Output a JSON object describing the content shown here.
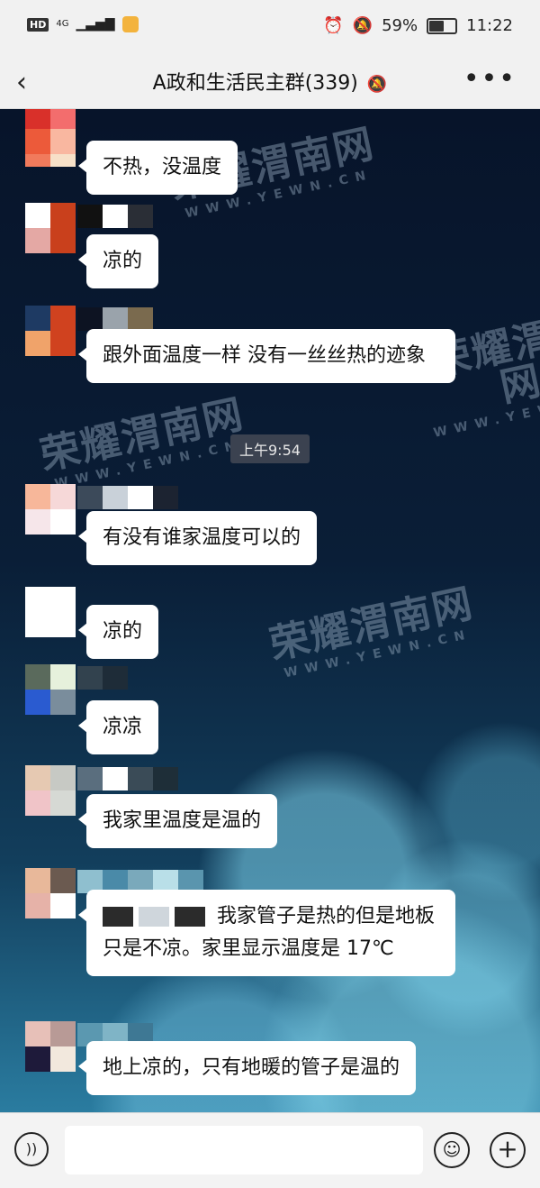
{
  "status_bar": {
    "hd": "HD",
    "network": "4G",
    "battery": "59%",
    "time": "11:22",
    "icons": [
      "alarm-icon",
      "mute-bell-icon",
      "battery-icon"
    ]
  },
  "header": {
    "back_icon": "‹",
    "title": "A政和生活民主群(339)",
    "mute_icon": "bell-off-icon",
    "more_icon": "•••"
  },
  "chat": {
    "timestamp": "上午9:54",
    "messages": [
      {
        "text": "不热，没温度"
      },
      {
        "text": "凉的"
      },
      {
        "text": "跟外面温度一样 没有一丝丝热的迹象"
      },
      {
        "text": "有没有谁家温度可以的"
      },
      {
        "text": "凉的"
      },
      {
        "text": "凉凉"
      },
      {
        "text": "我家里温度是温的"
      },
      {
        "text": "我家管子是热的但是地板只是不凉。家里显示温度是 17℃"
      },
      {
        "text": "地上凉的，只有地暖的管子是温的"
      }
    ],
    "watermark": {
      "main": "荣耀渭南网",
      "sub": "WWW.YEWN.CN"
    }
  },
  "input_bar": {
    "placeholder": "",
    "icons": [
      "voice-icon",
      "emoji-icon",
      "plus-icon"
    ]
  },
  "colors": {
    "bubble": "#ffffff",
    "bar": "#f1f1f1",
    "chat_bg_top": "#07142a",
    "chat_bg_bottom": "#2a7ca0"
  }
}
